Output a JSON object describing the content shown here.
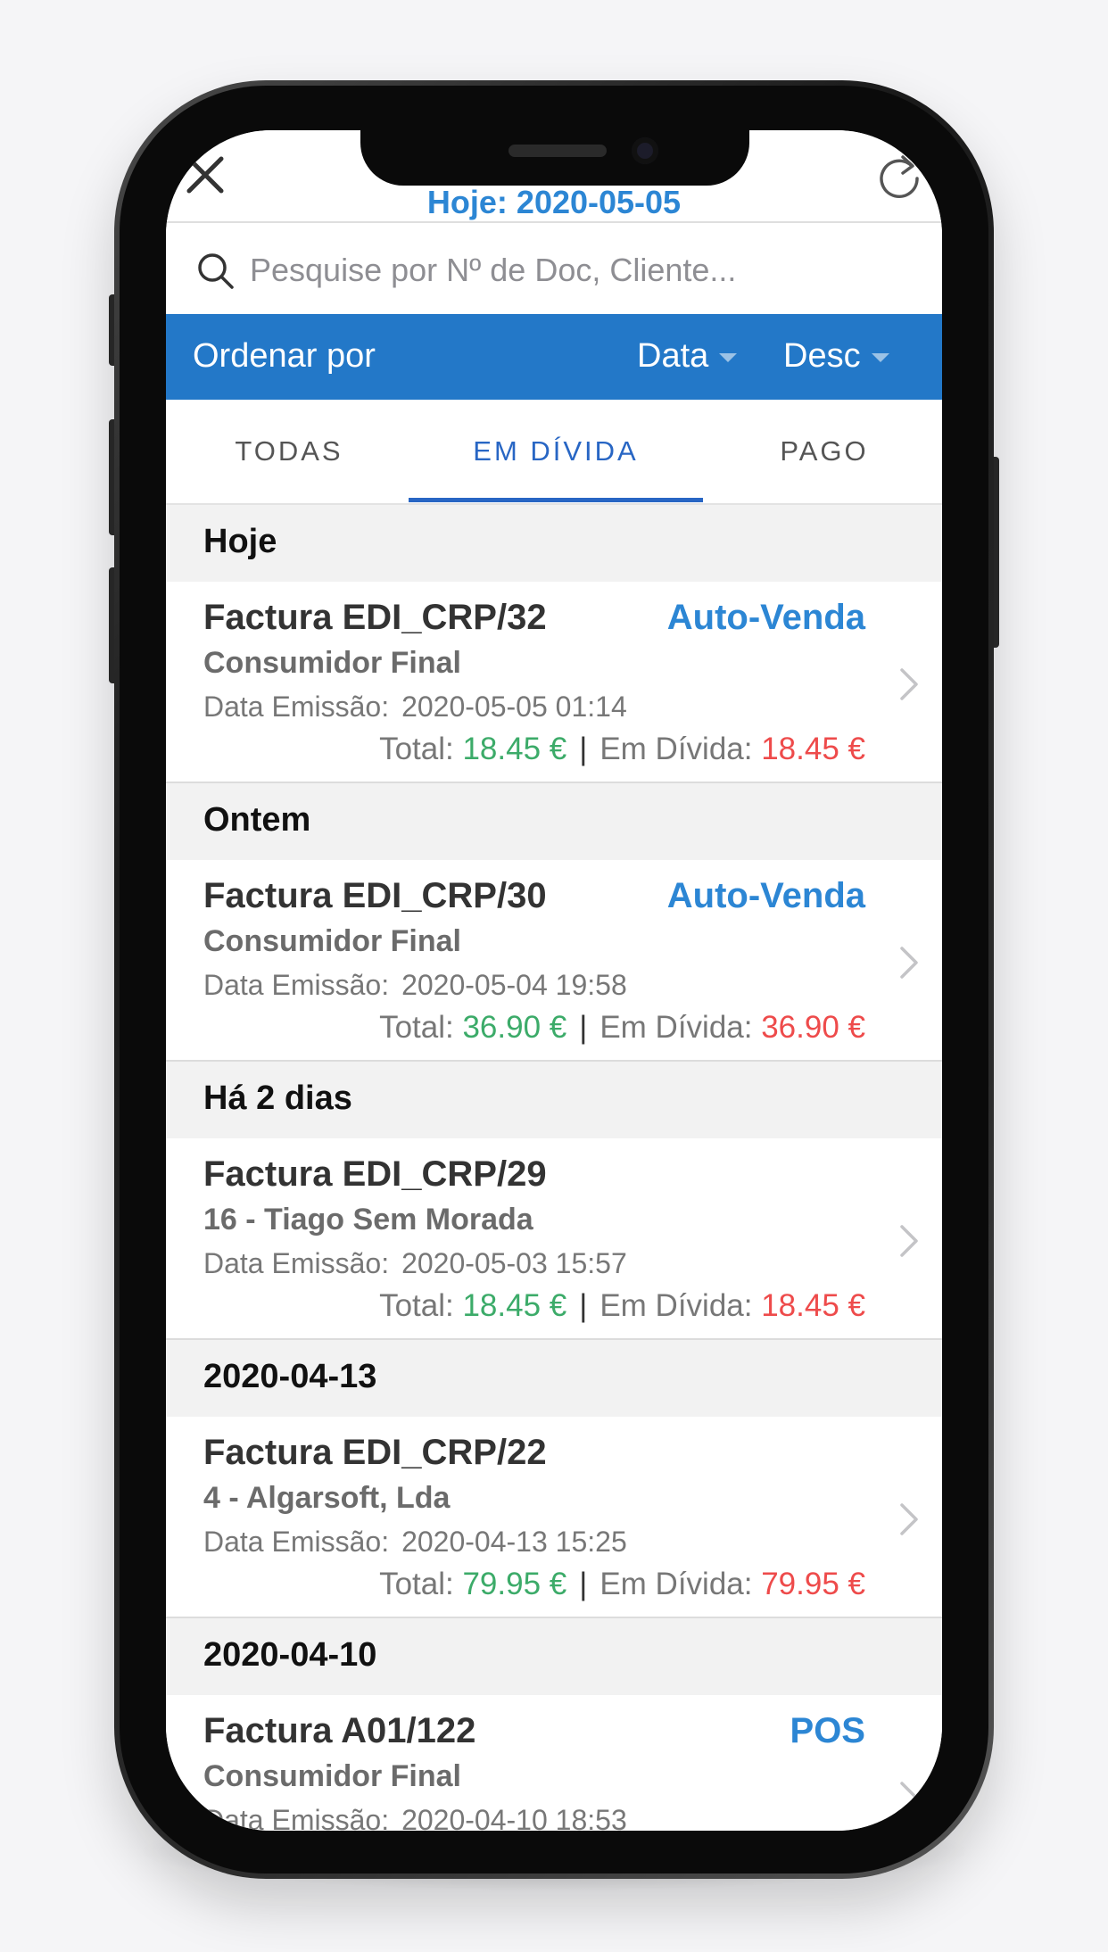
{
  "header": {
    "today_label": "Hoje: 2020-05-05"
  },
  "search": {
    "placeholder": "Pesquise por Nº de Doc, Cliente..."
  },
  "sort": {
    "label": "Ordenar por",
    "field": "Data",
    "order": "Desc"
  },
  "tabs": [
    {
      "label": "TODAS",
      "active": false
    },
    {
      "label": "EM DÍVIDA",
      "active": true
    },
    {
      "label": "PAGO",
      "active": false
    }
  ],
  "sections": [
    {
      "header": "Hoje",
      "item": {
        "title": "Factura EDI_CRP/32",
        "origin": "Auto-Venda",
        "client": "Consumidor Final",
        "issued_label": "Data Emissão:",
        "issued_date": "2020-05-05 01:14",
        "total_label": "Total:",
        "total": "18.45 €",
        "debt_label": "Em Dívida:",
        "debt": "18.45 €"
      }
    },
    {
      "header": "Ontem",
      "item": {
        "title": "Factura EDI_CRP/30",
        "origin": "Auto-Venda",
        "client": "Consumidor Final",
        "issued_label": "Data Emissão:",
        "issued_date": "2020-05-04 19:58",
        "total_label": "Total:",
        "total": "36.90 €",
        "debt_label": "Em Dívida:",
        "debt": "36.90 €"
      }
    },
    {
      "header": "Há 2 dias",
      "item": {
        "title": "Factura EDI_CRP/29",
        "origin": "",
        "client": "16 - Tiago Sem Morada",
        "issued_label": "Data Emissão:",
        "issued_date": "2020-05-03 15:57",
        "total_label": "Total:",
        "total": "18.45 €",
        "debt_label": "Em Dívida:",
        "debt": "18.45 €"
      }
    },
    {
      "header": "2020-04-13",
      "item": {
        "title": "Factura EDI_CRP/22",
        "origin": "",
        "client": "4 - Algarsoft, Lda",
        "issued_label": "Data Emissão:",
        "issued_date": "2020-04-13 15:25",
        "total_label": "Total:",
        "total": "79.95 €",
        "debt_label": "Em Dívida:",
        "debt": "79.95 €"
      }
    },
    {
      "header": "2020-04-10",
      "item": {
        "title": "Factura A01/122",
        "origin": "POS",
        "client": "Consumidor Final",
        "issued_label": "Data Emissão:",
        "issued_date": "2020-04-10 18:53"
      }
    }
  ],
  "colors": {
    "accent": "#2c86d4",
    "sortbar": "#2378c8",
    "tab_active": "#2866c4",
    "amount_total": "#3cab69",
    "amount_debt": "#ee4b4b"
  }
}
